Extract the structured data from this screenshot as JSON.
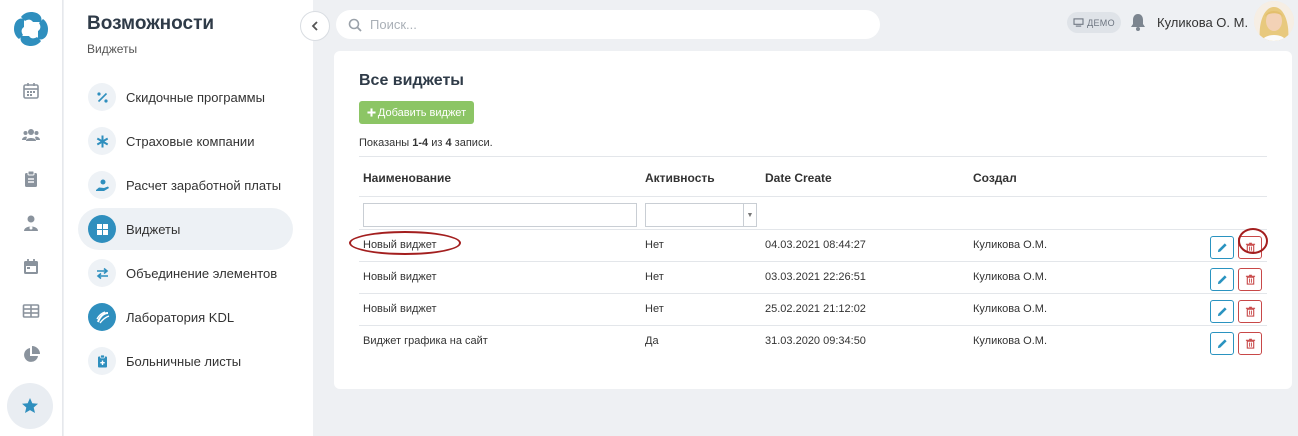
{
  "section": {
    "title": "Возможности",
    "subtitle": "Виджеты"
  },
  "rail": {
    "items": [
      {
        "icon": "calendar-icon"
      },
      {
        "icon": "users-icon"
      },
      {
        "icon": "clipboard-icon"
      },
      {
        "icon": "doctor-icon"
      },
      {
        "icon": "calendar-alt-icon"
      },
      {
        "icon": "table-icon"
      },
      {
        "icon": "pie-chart-icon"
      },
      {
        "icon": "star-icon",
        "active": true
      }
    ]
  },
  "menu": {
    "items": [
      {
        "label": "Скидочные программы",
        "icon": "percent-icon"
      },
      {
        "label": "Страховые компании",
        "icon": "asterisk-icon"
      },
      {
        "label": "Расчет заработной платы",
        "icon": "hand-money-icon"
      },
      {
        "label": "Виджеты",
        "icon": "widgets-icon",
        "active": true
      },
      {
        "label": "Объединение элементов",
        "icon": "exchange-icon"
      },
      {
        "label": "Лаборатория KDL",
        "icon": "kdl-logo-icon"
      },
      {
        "label": "Больничные листы",
        "icon": "medical-clipboard-icon"
      }
    ]
  },
  "topbar": {
    "search_placeholder": "Поиск...",
    "demo_badge": "ДЕМО",
    "user_name": "Куликова О. М."
  },
  "widgets": {
    "title": "Все виджеты",
    "add_button": "Добавить виджет",
    "summary_prefix": "Показаны ",
    "summary_range": "1-4",
    "summary_mid": " из ",
    "summary_total": "4",
    "summary_suffix": " записи.",
    "columns": {
      "name": "Наименование",
      "active": "Активность",
      "created": "Date Create",
      "author": "Создал"
    },
    "filter_name_value": "",
    "filter_active_value": "",
    "rows": [
      {
        "name": "Новый виджет",
        "active": "Нет",
        "created": "04.03.2021 08:44:27",
        "author": "Куликова О.М."
      },
      {
        "name": "Новый виджет",
        "active": "Нет",
        "created": "03.03.2021 22:26:51",
        "author": "Куликова О.М."
      },
      {
        "name": "Новый виджет",
        "active": "Нет",
        "created": "25.02.2021 21:12:02",
        "author": "Куликова О.М."
      },
      {
        "name": "Виджет графика на сайт",
        "active": "Да",
        "created": "31.03.2020 09:34:50",
        "author": "Куликова О.М."
      }
    ]
  },
  "colors": {
    "accent": "#2f8fbe",
    "add_button": "#8cc565",
    "delete": "#c84848",
    "annotation": "#a31e1e"
  }
}
